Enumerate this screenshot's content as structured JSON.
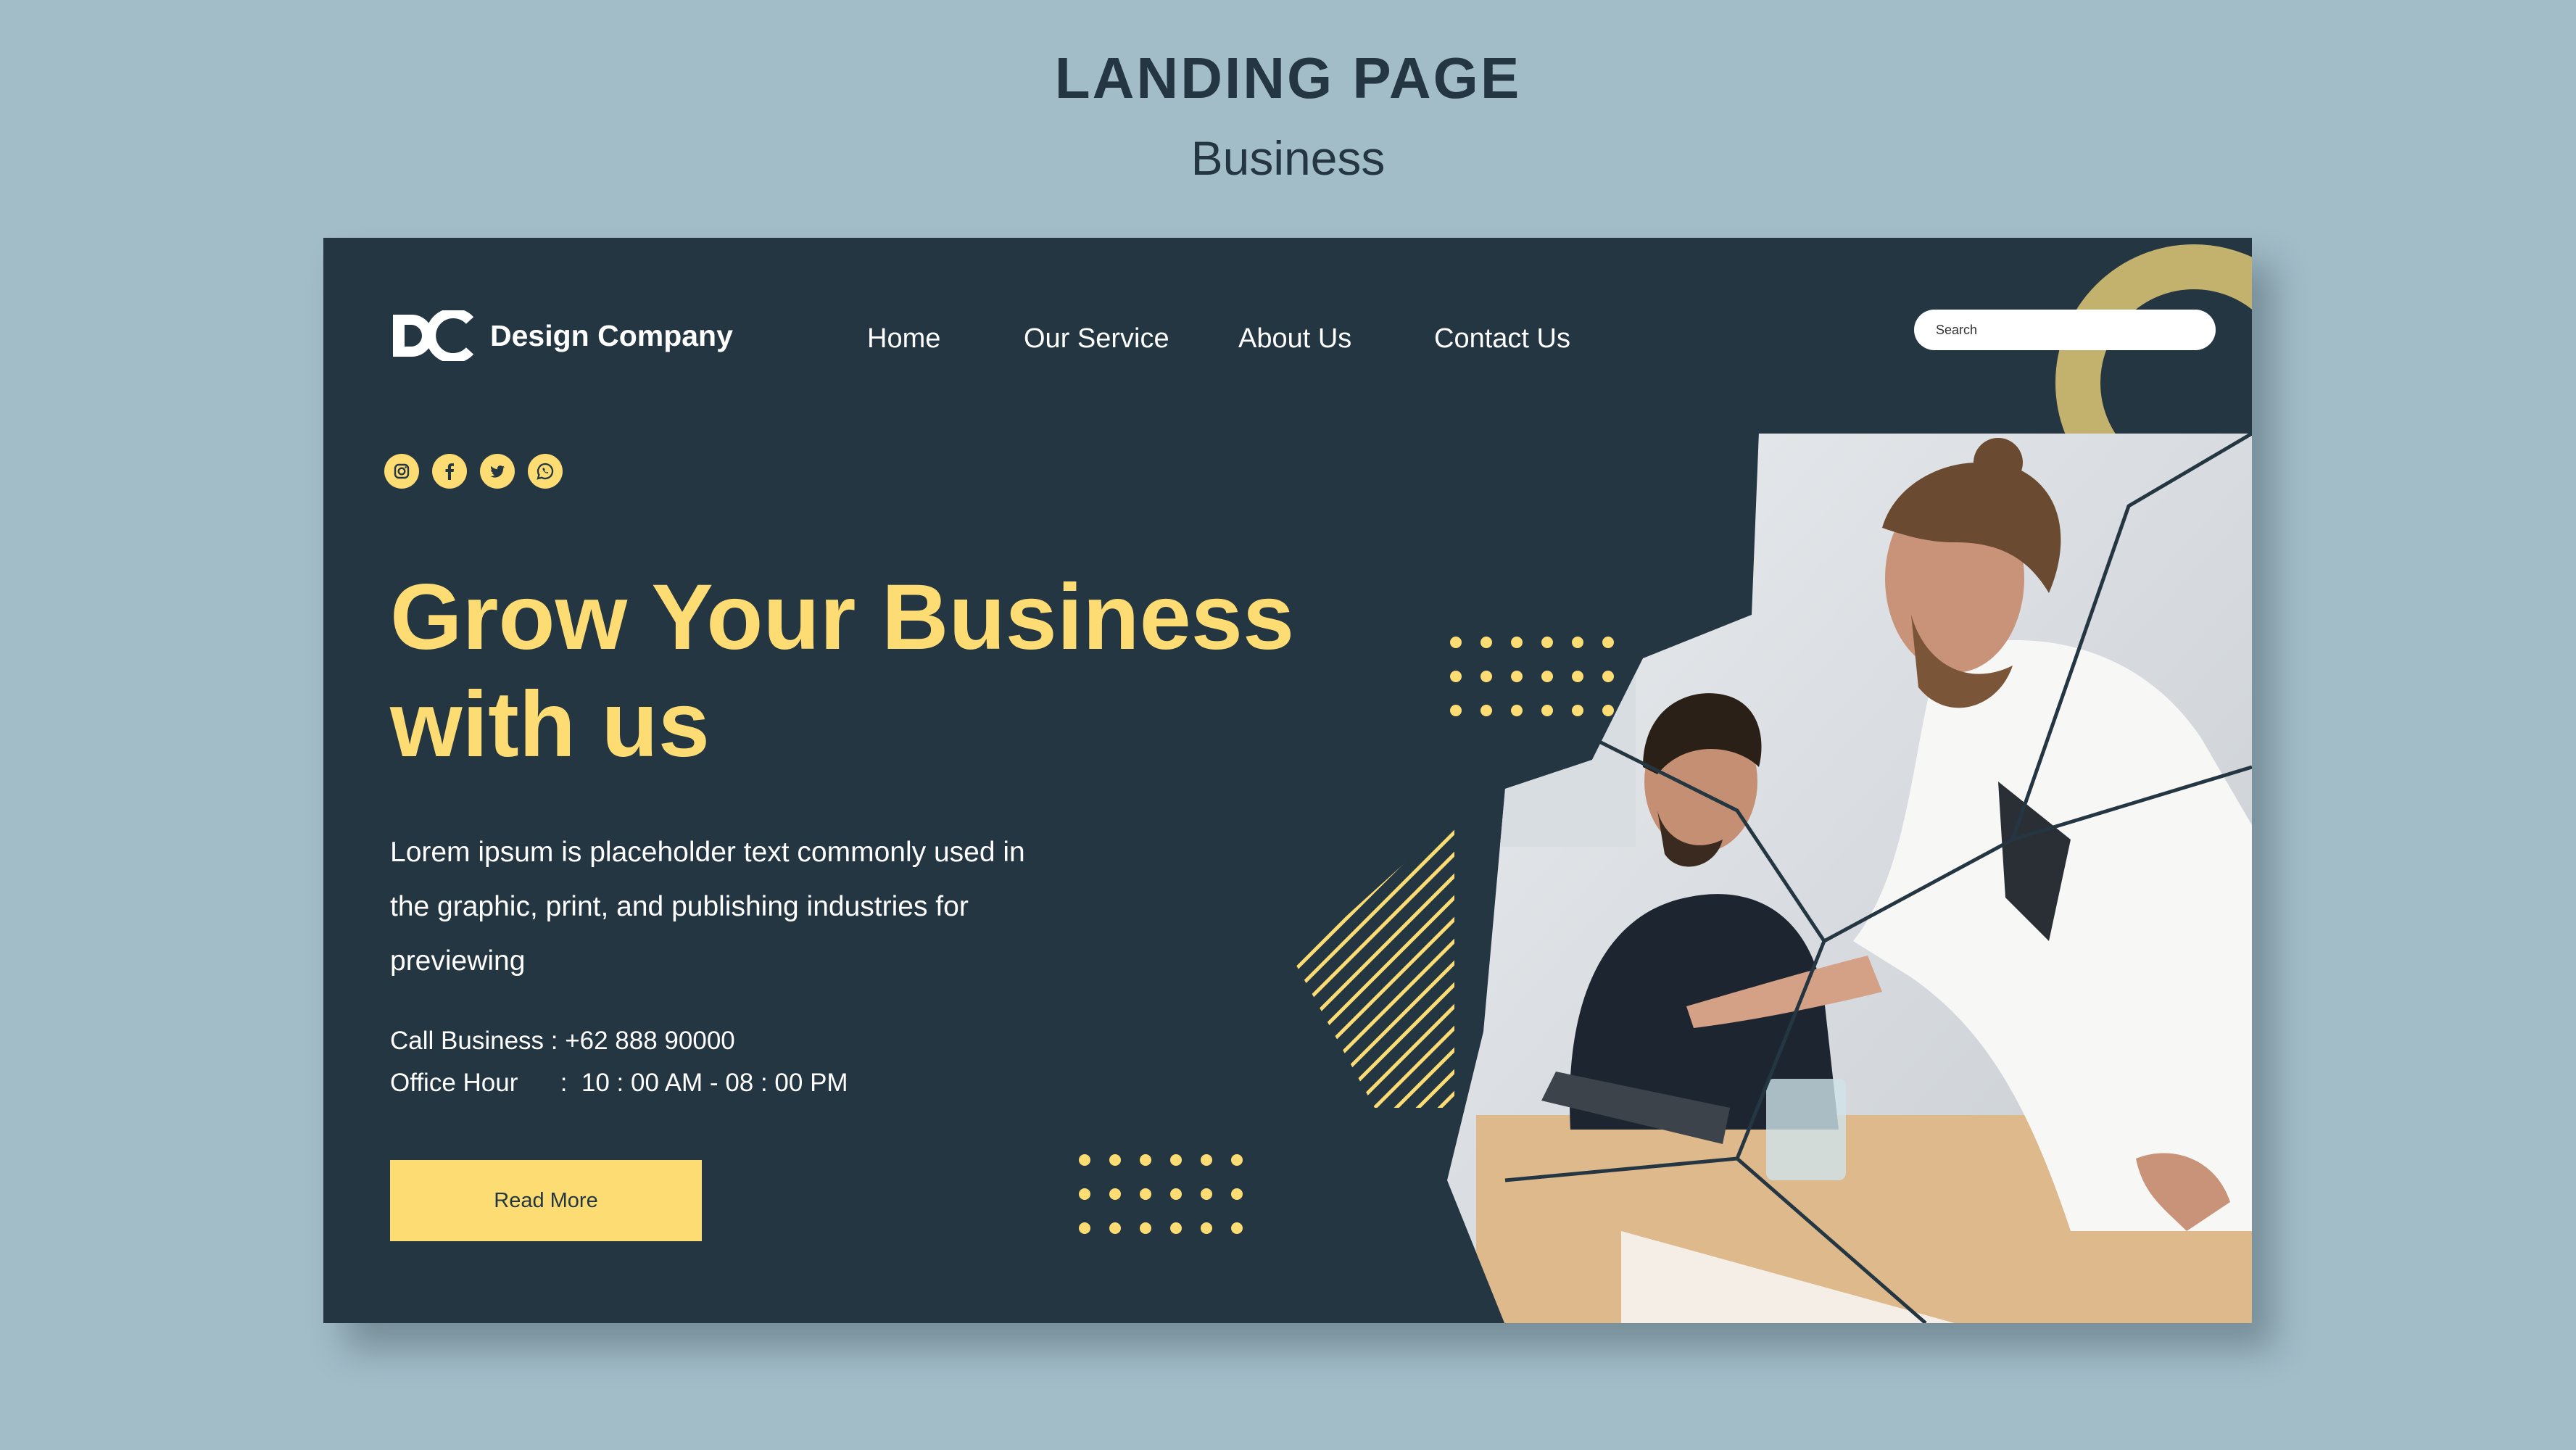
{
  "header": {
    "title": "LANDING PAGE",
    "subtitle": "Business"
  },
  "site": {
    "logo_text": "Design Company",
    "nav": [
      "Home",
      "Our Service",
      "About Us",
      "Contact Us"
    ],
    "search_placeholder": "Search",
    "socials": [
      "instagram-icon",
      "facebook-icon",
      "twitter-icon",
      "whatsapp-icon"
    ]
  },
  "hero": {
    "headline_line1": "Grow Your Business",
    "headline_line2": "with us",
    "description_lines": [
      "Lorem ipsum is placeholder text commonly used in",
      "the graphic, print, and publishing industries for",
      "previewing"
    ],
    "call_business": "Call Business : +62 888 90000",
    "office_hour": "Office Hour      :  10 : 00 AM - 08 : 00 PM",
    "read_more": "Read More"
  },
  "colors": {
    "page_bg": "#a2bcc8",
    "card_bg": "#243642",
    "accent_yellow": "#fddd73",
    "ring_gold": "#c3b26d",
    "text_white": "#ffffff"
  }
}
